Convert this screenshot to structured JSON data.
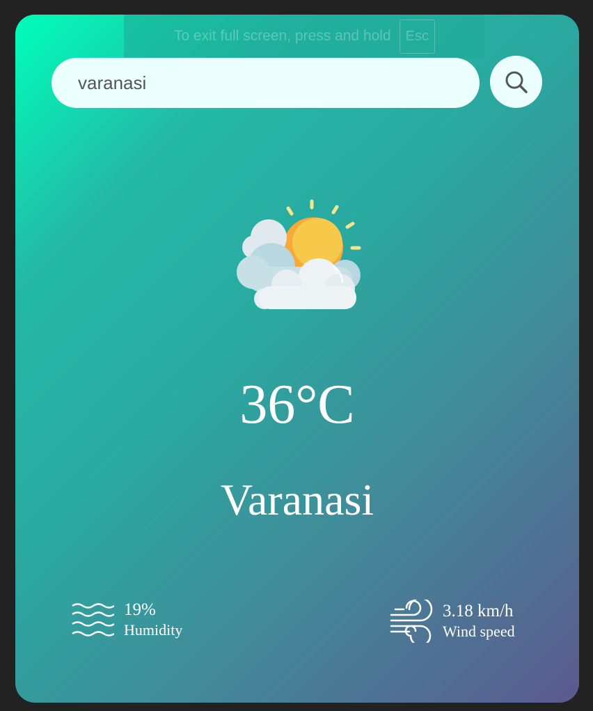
{
  "fullscreen_notice": {
    "text": "To exit full screen, press and hold",
    "key": "Esc"
  },
  "search": {
    "value": "varanasi",
    "button_icon": "search-icon"
  },
  "weather": {
    "icon": "partly-cloudy-sun-icon",
    "temperature": "36°C",
    "city": "Varanasi"
  },
  "details": {
    "humidity": {
      "icon": "humidity-waves-icon",
      "value": "19%",
      "label": "Humidity"
    },
    "wind": {
      "icon": "wind-icon",
      "value": "3.18 km/h",
      "label": "Wind speed"
    }
  },
  "colors": {
    "page_background": "#222222",
    "gradient_start": "#00feba",
    "gradient_end": "#5b5a8e",
    "input_background": "#ebfffc"
  }
}
